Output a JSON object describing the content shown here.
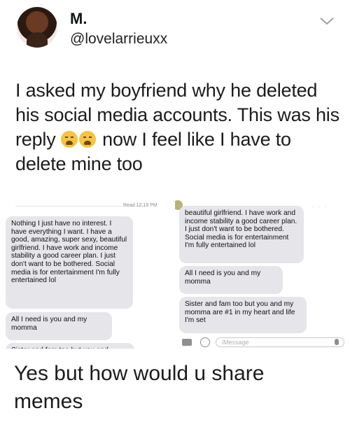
{
  "tweet": {
    "name": "M.",
    "handle": "@lovelarrieuxx",
    "text_part1": "I asked my boyfriend why he deleted his social media accounts. This was his reply",
    "text_part2": "now I feel like I have to delete mine too",
    "emoji_name": "weary-face-emoji"
  },
  "screenshot_left": {
    "read_receipt": "Read 12:19 PM",
    "messages": [
      "Nothing I just have no interest. I have everything I want. I have a good, amazing, super sexy, beautiful girlfriend. I have work and income stability a good career plan. I just don't want to be bothered. Social media is for entertainment I'm fully entertained lol",
      "All I need is you and my momma",
      "Sister and fam too but you and"
    ]
  },
  "screenshot_right": {
    "messages": [
      "beautiful girlfriend. I have work and income stability a good career plan. I just don't want to be bothered. Social media is for entertainment I'm fully entertained lol",
      "All I need is you and my momma",
      "Sister and fam too but you and my momma are #1 in my heart and life I'm set"
    ],
    "input_placeholder": "iMessage"
  },
  "caption": "Yes but how would u share memes",
  "colors": {
    "bubble_gray": "#e5e5ea",
    "text": "#14171a"
  }
}
